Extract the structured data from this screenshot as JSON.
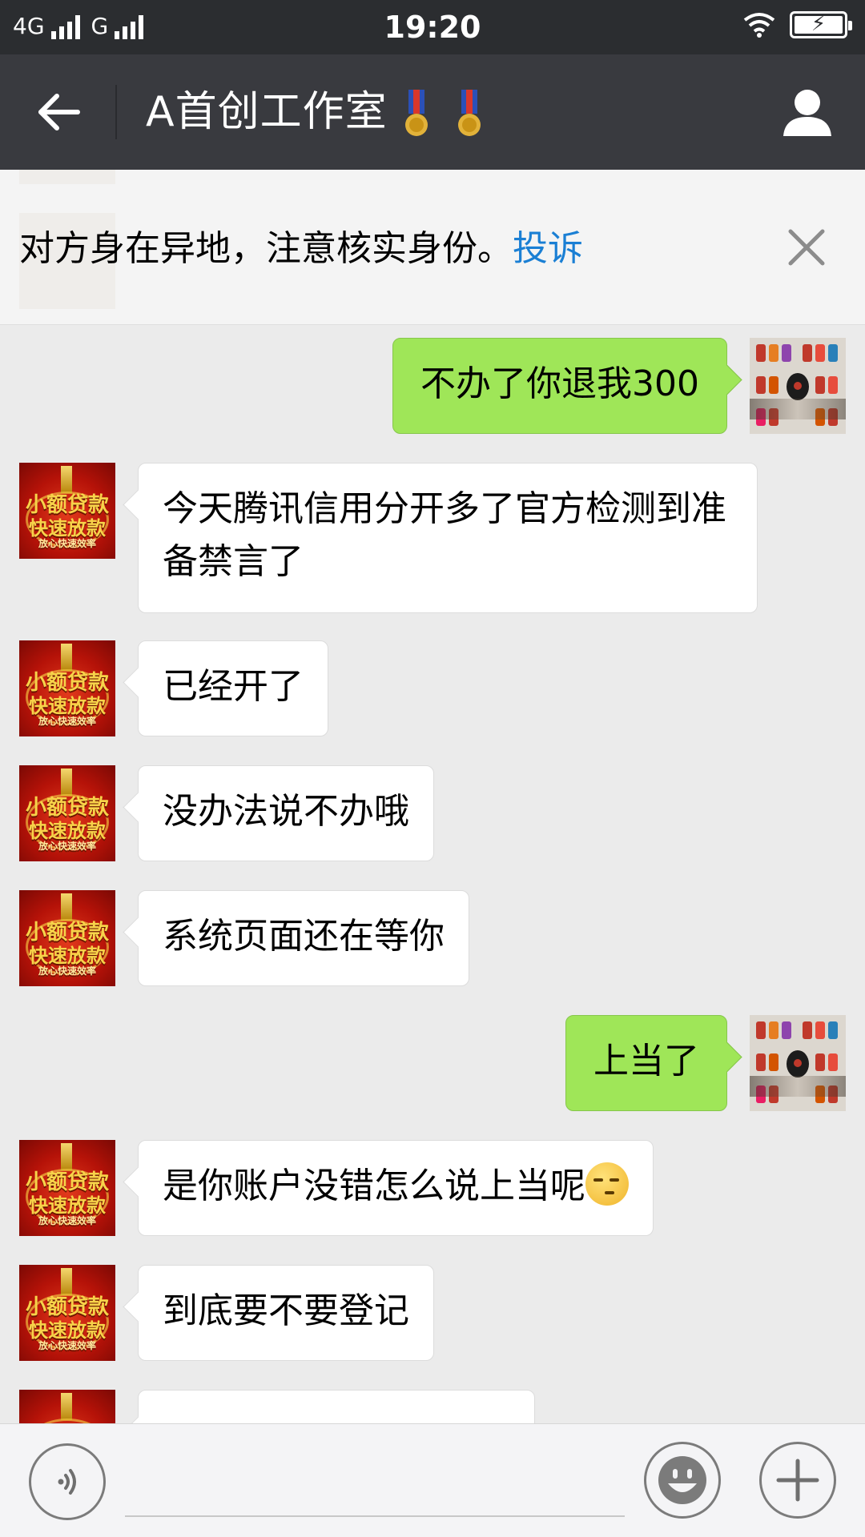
{
  "status_bar": {
    "network_1": "4G",
    "network_2": "G",
    "time": "19:20"
  },
  "header": {
    "title": "A首创工作室",
    "medal_icons": [
      "medal-icon",
      "medal-icon"
    ],
    "back_icon": "back-arrow-icon",
    "profile_icon": "person-icon"
  },
  "notice": {
    "text": "对方身在异地，注意核实身份。",
    "link": "投诉",
    "close_icon": "close-icon"
  },
  "avatars": {
    "contact": {
      "line1": "小额贷款",
      "line2": "快速放款",
      "line3": "放心快速效率"
    }
  },
  "messages": [
    {
      "from": "me",
      "text": "不办了你退我300"
    },
    {
      "from": "contact",
      "text": "今天腾讯信用分开多了官方检测到准备禁言了"
    },
    {
      "from": "contact",
      "text": "已经开了"
    },
    {
      "from": "contact",
      "text": "没办法说不办哦"
    },
    {
      "from": "contact",
      "text": "系统页面还在等你"
    },
    {
      "from": "me",
      "text": "上当了"
    },
    {
      "from": "contact",
      "text": "是你账户没错怎么说上当呢"
    },
    {
      "from": "contact",
      "text": "到底要不要登记"
    }
  ],
  "input_bar": {
    "voice_icon": "voice-icon",
    "emoji_icon": "emoji-icon",
    "plus_icon": "plus-icon",
    "placeholder": ""
  },
  "colors": {
    "status_bar": "#2b2d30",
    "title_bar": "#393a3f",
    "chat_background": "#ebebeb",
    "outgoing_bubble": "#9fe658",
    "incoming_bubble": "#ffffff",
    "link": "#1a7fd4"
  }
}
